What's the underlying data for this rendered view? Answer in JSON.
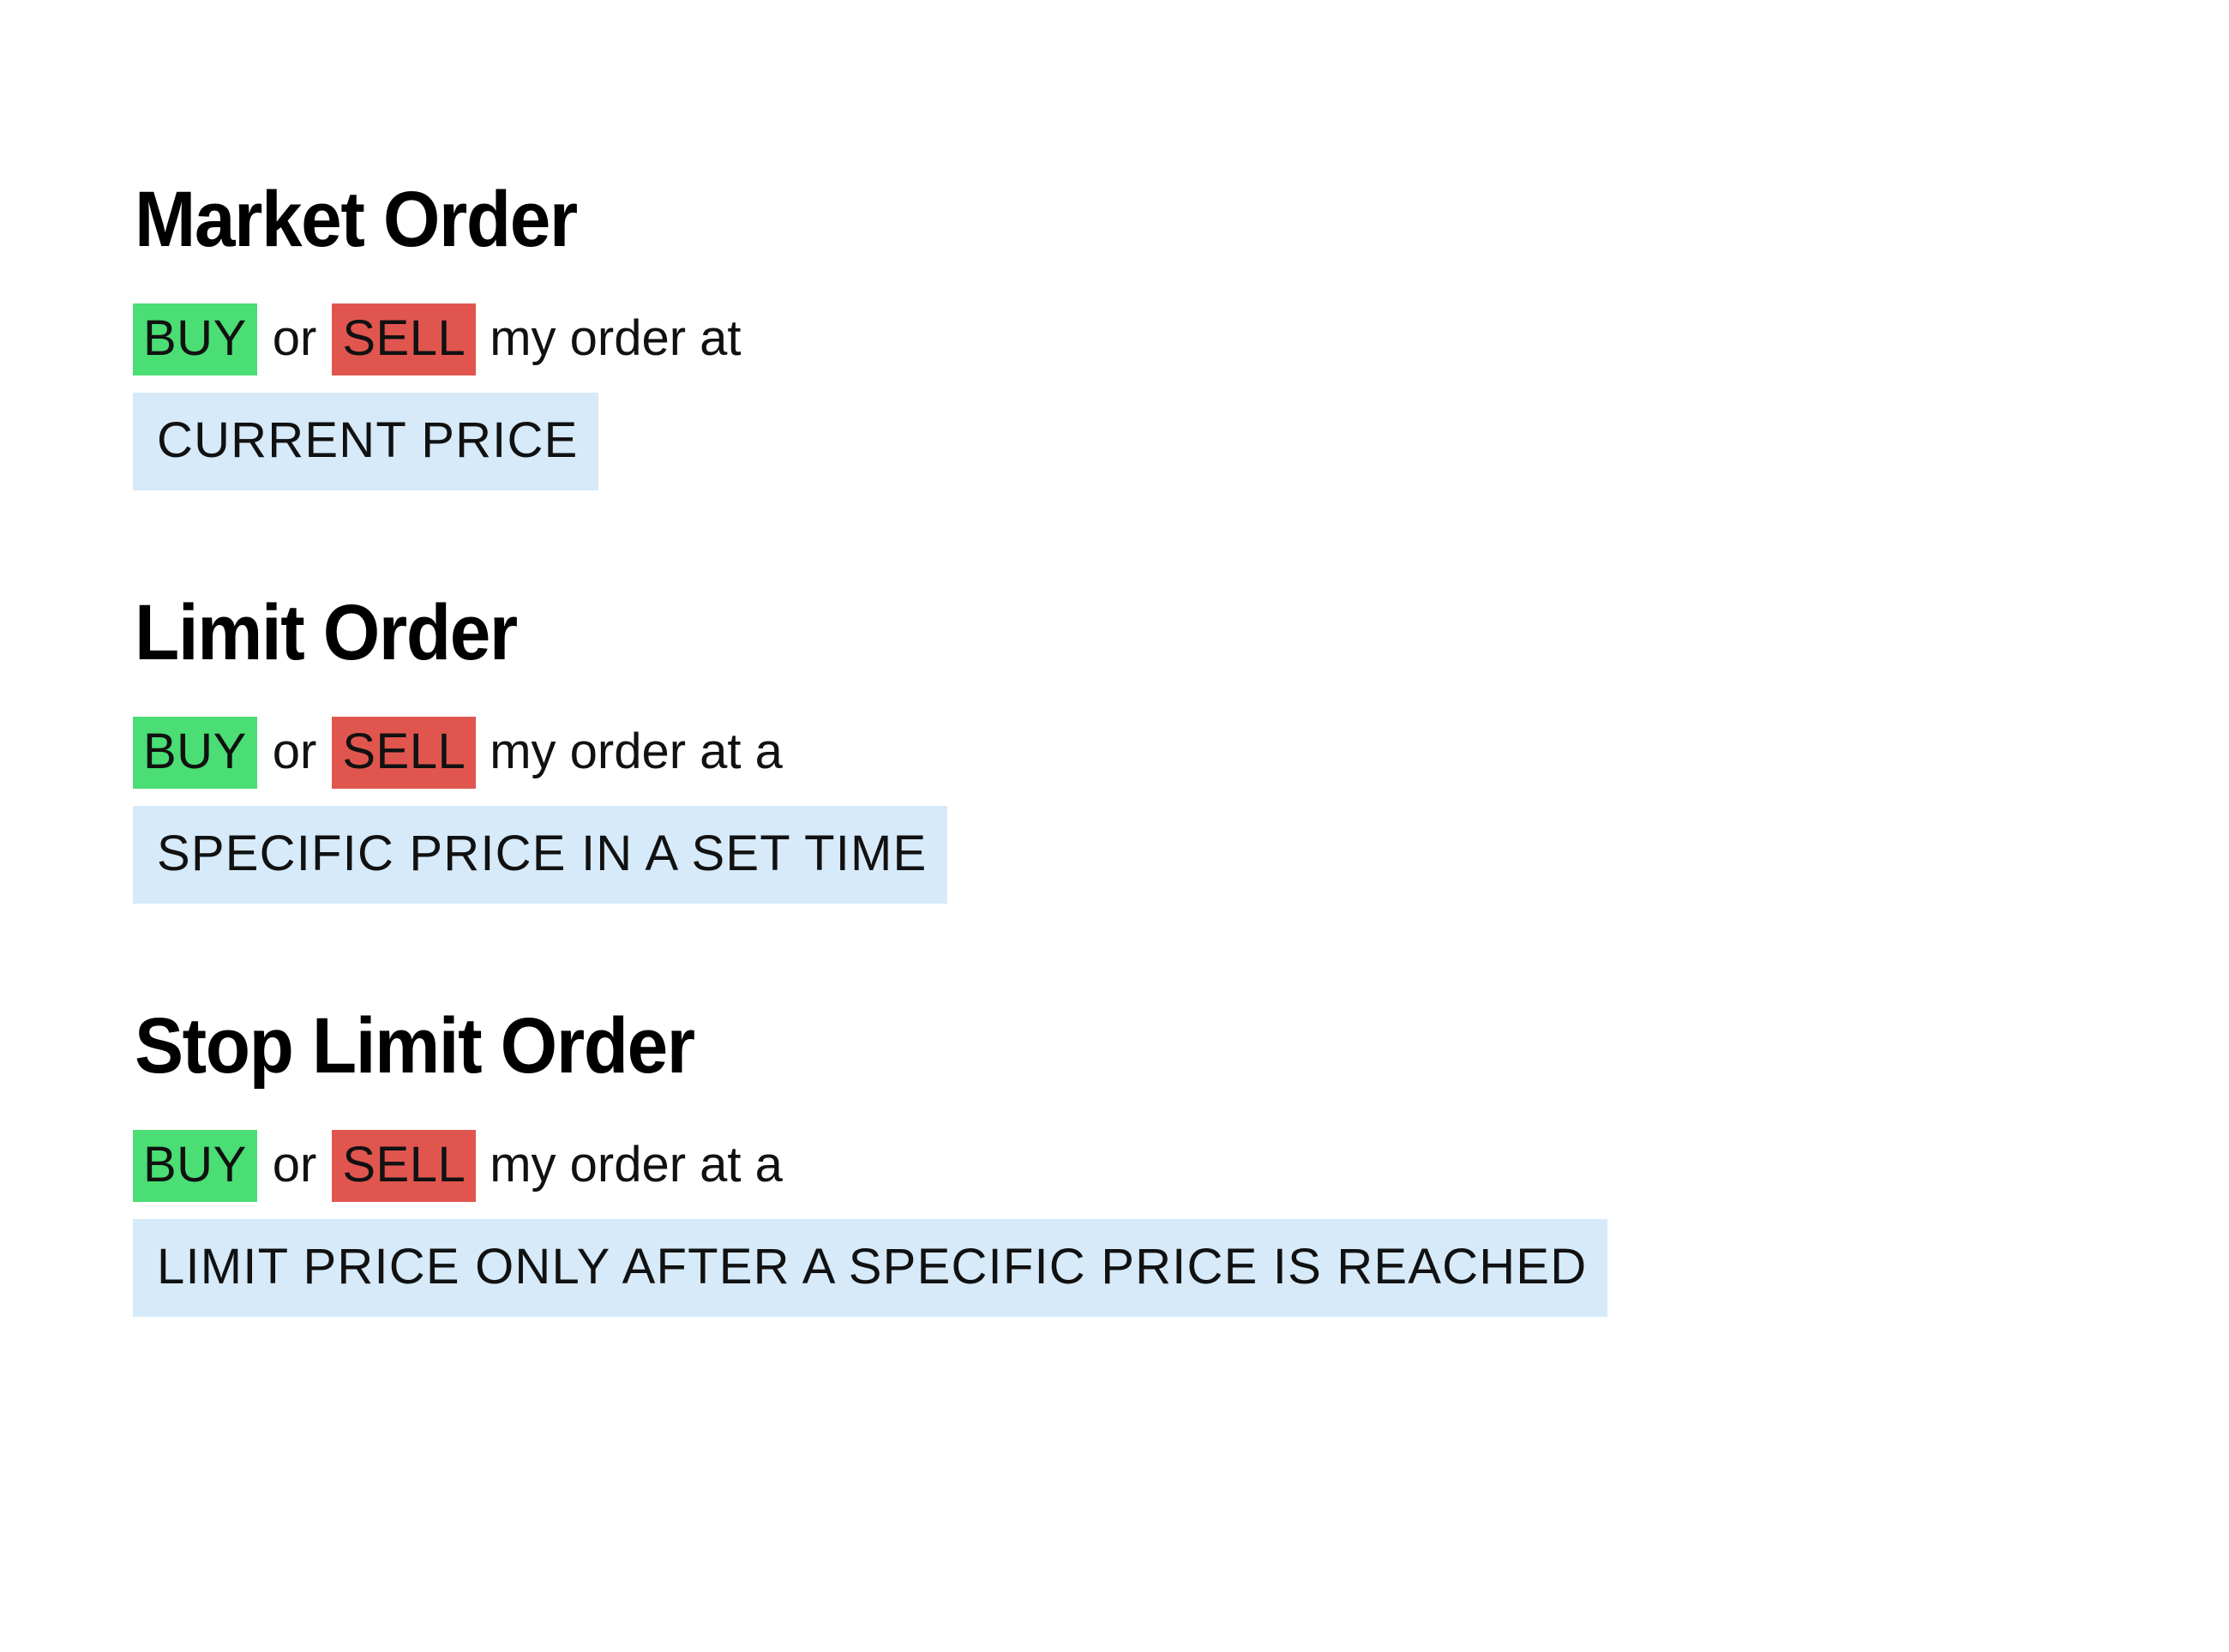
{
  "page": {
    "background_color": "#ffffff",
    "text_color": "#111111"
  },
  "colors": {
    "buy_chip_bg": "#4ade74",
    "sell_chip_bg": "#e0564f",
    "detail_chip_bg": "#d6eaf9",
    "heading": "#000000"
  },
  "sections": [
    {
      "title": "Market Order",
      "buy_label": "BUY",
      "conjunction": "or",
      "sell_label": "SELL",
      "tail": "my order at",
      "detail": "CURRENT PRICE"
    },
    {
      "title": "Limit Order",
      "buy_label": "BUY",
      "conjunction": "or",
      "sell_label": "SELL",
      "tail": "my order at a",
      "detail": "SPECIFIC PRICE IN A SET TIME"
    },
    {
      "title": "Stop Limit Order",
      "buy_label": "BUY",
      "conjunction": "or",
      "sell_label": "SELL",
      "tail": "my order at a",
      "detail": "LIMIT PRICE ONLY AFTER A SPECIFIC PRICE IS REACHED"
    }
  ]
}
